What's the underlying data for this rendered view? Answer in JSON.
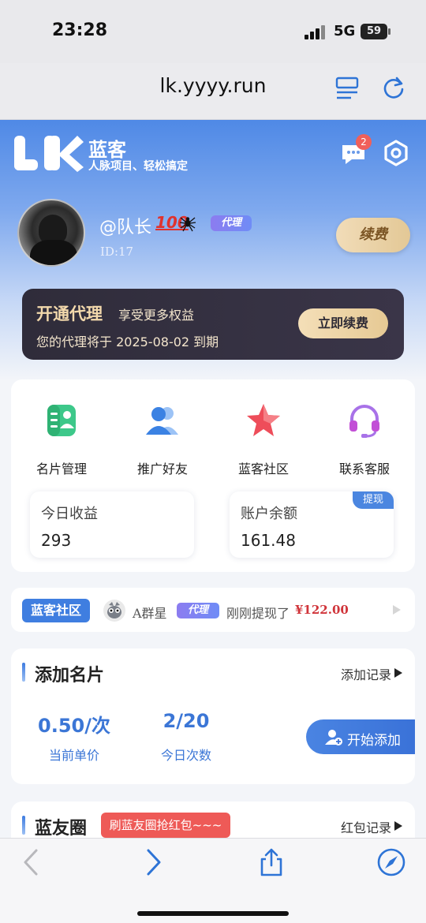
{
  "status_bar": {
    "time": "23:28",
    "network": "5G",
    "battery": "59"
  },
  "address_bar": {
    "url": "lk.yyyy.run"
  },
  "header": {
    "brand_name": "蓝客",
    "slogan": "人脉项目、轻松搞定",
    "message_count": "2"
  },
  "profile": {
    "username": "@队长",
    "emoji": "100",
    "role_badge": "代理",
    "user_id": "ID:17",
    "renew_label": "续费"
  },
  "vip": {
    "title": "开通代理",
    "subtitle": "享受更多权益",
    "expire_text": "您的代理将于 2025-08-02 到期",
    "button_label": "立即续费"
  },
  "menu": {
    "items": [
      {
        "label": "名片管理",
        "icon": "card-manage-icon"
      },
      {
        "label": "推广好友",
        "icon": "friends-icon"
      },
      {
        "label": "蓝客社区",
        "icon": "star-icon"
      },
      {
        "label": "联系客服",
        "icon": "headset-icon"
      }
    ]
  },
  "stats": {
    "today_income_label": "今日收益",
    "today_income_value": "293",
    "balance_label": "账户余额",
    "balance_value": "161.48",
    "withdraw_label": "提现"
  },
  "ticker": {
    "tag": "蓝客社区",
    "name": "A群星",
    "badge": "代理",
    "text": "刚刚提现了",
    "amount": "¥122.00"
  },
  "add_card": {
    "title": "添加名片",
    "record_link": "添加记录",
    "price_value": "0.50/次",
    "price_label": "当前单价",
    "count_value": "2/20",
    "count_label": "今日次数",
    "start_button": "开始添加"
  },
  "friends_section": {
    "title": "蓝友圈",
    "tag": "刷蓝友圈抢红包~~~",
    "record_link": "红包记录"
  },
  "colors": {
    "primary": "#3f7ee0",
    "accent_gold": "#e6c994",
    "badge_red": "#ee5a57",
    "amount_red": "#d0343a"
  }
}
